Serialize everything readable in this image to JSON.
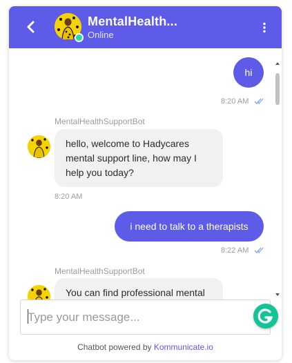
{
  "header": {
    "title": "MentalHealth...",
    "status": "Online",
    "accent": "#5e5be8"
  },
  "messages": [
    {
      "kind": "out",
      "text": "hi",
      "time": "8:20 AM"
    },
    {
      "kind": "in",
      "sender": "MentalHealthSupportBot",
      "text": "hello, welcome to Hadycares mental support line, how may I help you today?",
      "time": "8:20 AM"
    },
    {
      "kind": "out",
      "text": "i need to talk to a therapists",
      "time": "8:22 AM"
    },
    {
      "kind": "in",
      "sender": "MentalHealthSupportBot",
      "text": "You can find professional mental health support at"
    }
  ],
  "input": {
    "placeholder": "Type your message..."
  },
  "footer": {
    "prefix": "Chatbot powered by ",
    "brand": "Kommunicate.io"
  },
  "icons": {
    "back": "chevron-left-icon",
    "menu": "kebab-menu-icon",
    "attach": "paperclip-icon",
    "read": "double-check-icon",
    "grammarly": "grammarly-icon"
  }
}
